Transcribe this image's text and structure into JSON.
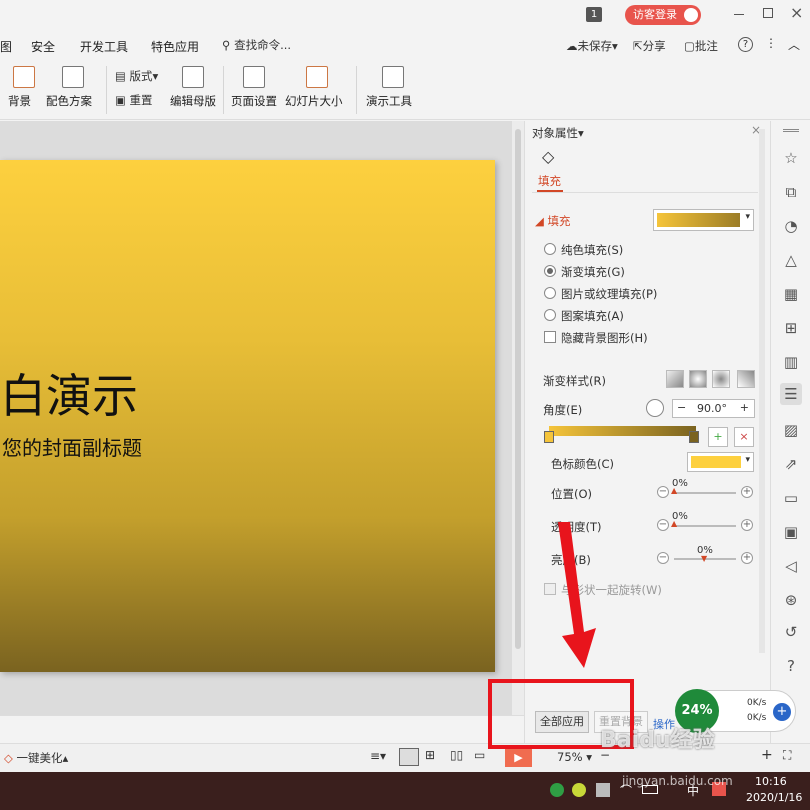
{
  "titlebar": {
    "badge": "1",
    "login": "访客登录"
  },
  "menus": [
    "图",
    "安全",
    "开发工具",
    "特色应用"
  ],
  "search": {
    "placeholder": "查找命令..."
  },
  "actions": {
    "save": "未保存",
    "share": "分享",
    "comment": "批注",
    "help": "?"
  },
  "ribbon": {
    "bg": "背景",
    "scheme": "配色方案",
    "layout": "版式",
    "reset": "重置",
    "master": "编辑母版",
    "pagesetup": "页面设置",
    "slidesize": "幻灯片大小",
    "presenttools": "演示工具"
  },
  "slide": {
    "title": "白演示",
    "subtitle": "您的封面副标题"
  },
  "panel": {
    "header": "对象属性",
    "tab": "填充",
    "section": "填充",
    "options": [
      "纯色填充(S)",
      "渐变填充(G)",
      "图片或纹理填充(P)",
      "图案填充(A)"
    ],
    "hide_bg": "隐藏背景图形(H)",
    "grad_style": "渐变样式(R)",
    "angle": "角度(E)",
    "angle_value": "90.0°",
    "stop_color": "色标颜色(C)",
    "position": "位置(O)",
    "position_value": "0%",
    "transparency": "透明度(T)",
    "transparency_value": "0%",
    "brightness": "亮度(B)",
    "brightness_value": "0%",
    "rotate": "与形状一起旋转(W)",
    "apply_all": "全部应用",
    "reset_bg": "重置背景",
    "ops": "操作"
  },
  "status": {
    "beautify": "一键美化",
    "zoom": "75%"
  },
  "netspeed": {
    "percent": "24%",
    "up": "0K/s",
    "down": "0K/s"
  },
  "taskbar": {
    "time": "10:16",
    "date": "2020/1/16",
    "ime": "中"
  },
  "watermark": {
    "text": "Baidu经验",
    "url": "jingyan.baidu.com"
  },
  "colors": {
    "accent": "#d24726",
    "login": "#e8544c",
    "gradient_top": "#fdd03e",
    "gradient_bottom": "#7a6320",
    "annot": "#e8141c"
  }
}
